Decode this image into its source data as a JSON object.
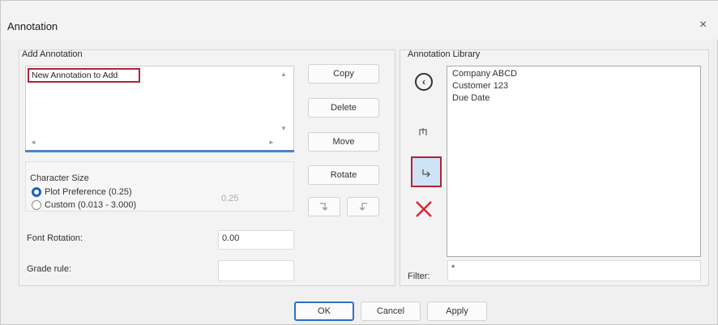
{
  "window": {
    "title": "Annotation",
    "close": "×"
  },
  "add_annotation": {
    "group_label": "Add Annotation",
    "input_value": "New Annotation to Add",
    "scroll_up": "▲",
    "scroll_down": "▼",
    "scroll_left": "◄",
    "scroll_right": "►"
  },
  "actions": {
    "copy": "Copy",
    "delete": "Delete",
    "move": "Move",
    "rotate": "Rotate"
  },
  "character_size": {
    "group_label": "Character Size",
    "plot_preference": "Plot Preference (0.25)",
    "custom": "Custom (0.013 - 3.000)",
    "custom_value": "0.25"
  },
  "font_rotation": {
    "label": "Font Rotation:",
    "value": "0.00"
  },
  "grade_rule": {
    "label": "Grade rule:",
    "value": ""
  },
  "library": {
    "group_label": "Annotation Library",
    "items": [
      "Company ABCD",
      "Customer 123",
      "Due Date"
    ],
    "filter_label": "Filter:",
    "filter_value": "*"
  },
  "footer": {
    "ok": "OK",
    "cancel": "Cancel",
    "apply": "Apply"
  },
  "colors": {
    "accent": "#2d6fc4",
    "highlight": "#b0233a",
    "delete": "#d6283a"
  }
}
